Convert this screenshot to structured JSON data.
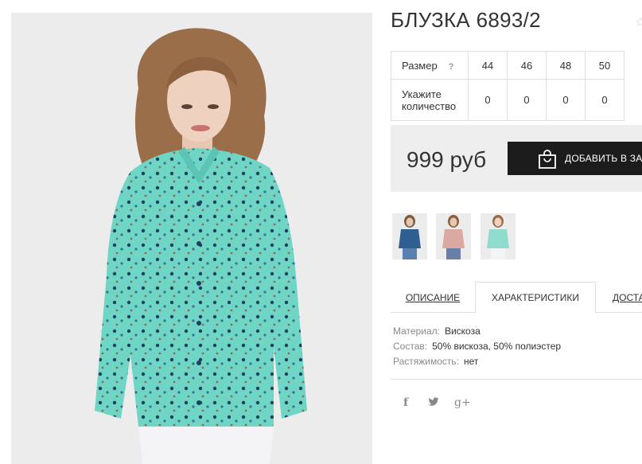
{
  "product": {
    "title": "БЛУЗКА 6893/2",
    "price": "999 руб"
  },
  "size_table": {
    "size_label": "Размер",
    "help_icon": "?",
    "qty_label": "Укажите количество",
    "sizes": [
      "44",
      "46",
      "48",
      "50"
    ],
    "quantities": [
      "0",
      "0",
      "0",
      "0"
    ]
  },
  "cart": {
    "add_label": "ДОБАВИТЬ В ЗАК"
  },
  "tabs": [
    {
      "label": "ОПИСАНИЕ"
    },
    {
      "label": "ХАРАКТЕРИСТИКИ"
    },
    {
      "label": "ДОСТА"
    }
  ],
  "specs": [
    {
      "key": "Материал:",
      "value": "Вискоза"
    },
    {
      "key": "Состав:",
      "value": "50% вискоза, 50% полиэстер"
    },
    {
      "key": "Растяжимость:",
      "value": "нет"
    }
  ],
  "social": {
    "facebook": "f",
    "twitter": "t",
    "google": "g+"
  },
  "colors": {
    "blouse_mint": "#6fd6c6",
    "button_dark": "#1c1c1c",
    "price_bg": "#eeeeee",
    "thumb_navy": "#2f5f91",
    "thumb_pink": "#d9a9a2"
  }
}
